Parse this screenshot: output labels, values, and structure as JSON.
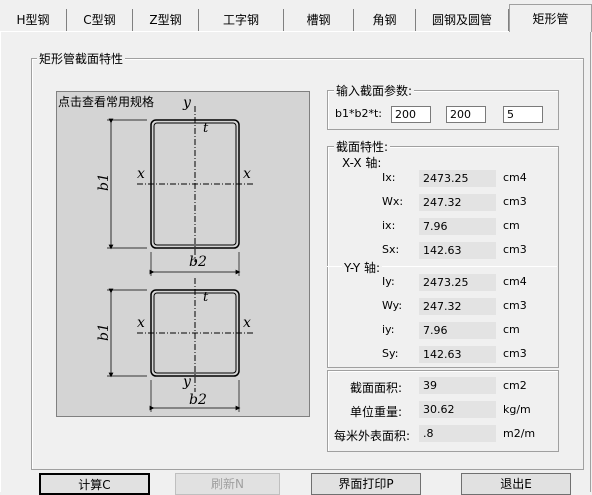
{
  "tabs": [
    "H型钢",
    "C型钢",
    "Z型钢",
    "工字钢",
    "槽钢",
    "角钢",
    "圆钢及圆管",
    "矩形管"
  ],
  "group_title": "矩形管截面特性",
  "figure": {
    "caption": "点击查看常用规格",
    "labels": {
      "y_top": "y",
      "x_left": "x",
      "x_right": "x",
      "t": "t",
      "b1": "b1",
      "b2": "b2",
      "y_bottom": "y"
    }
  },
  "input": {
    "title": "输入截面参数:",
    "param_label": "b1*b2*t:",
    "b1": "200",
    "b2": "200",
    "t": "5"
  },
  "properties": {
    "title": "截面特性:",
    "xx_label": "X-X 轴:",
    "yy_label": "Y-Y 轴:",
    "xx_rows": [
      {
        "name": "Ix:",
        "value": "2473.25",
        "unit": "cm4"
      },
      {
        "name": "Wx:",
        "value": "247.32",
        "unit": "cm3"
      },
      {
        "name": "ix:",
        "value": "7.96",
        "unit": "cm"
      },
      {
        "name": "Sx:",
        "value": "142.63",
        "unit": "cm3"
      }
    ],
    "yy_rows": [
      {
        "name": "Iy:",
        "value": "2473.25",
        "unit": "cm4"
      },
      {
        "name": "Wy:",
        "value": "247.32",
        "unit": "cm3"
      },
      {
        "name": "iy:",
        "value": "7.96",
        "unit": "cm"
      },
      {
        "name": "Sy:",
        "value": "142.63",
        "unit": "cm3"
      }
    ],
    "area": {
      "name": "截面面积:",
      "value": "39",
      "unit": "cm2"
    },
    "weight": {
      "name": "单位重量:",
      "value": "30.62",
      "unit": "kg/m"
    },
    "surface": {
      "name": "每米外表面积:",
      "value": ".8",
      "unit": "m2/m"
    }
  },
  "buttons": {
    "calc": "计算C",
    "print": "刷新N",
    "page_print": "界面打印P",
    "exit": "退出E"
  }
}
